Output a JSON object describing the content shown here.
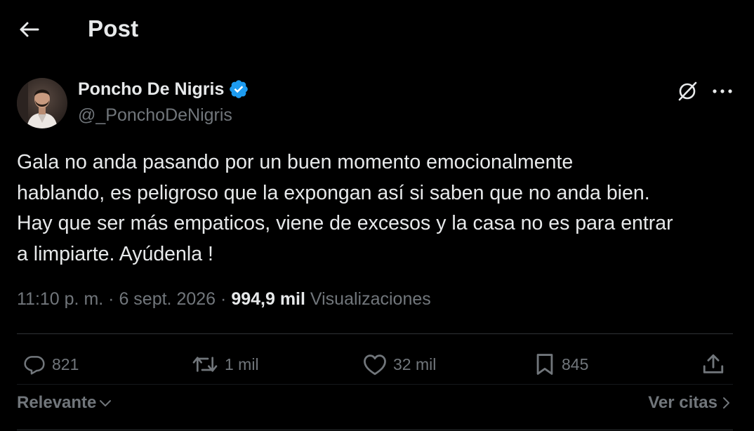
{
  "header": {
    "title": "Post",
    "back_icon": "arrow-left-icon"
  },
  "author": {
    "name": "Poncho De Nigris",
    "handle": "@_PonchoDeNigris",
    "verified": true,
    "verified_color": "#1d9bf0"
  },
  "tweet": {
    "lines": [
      "Gala no anda pasando por un buen momento emocionalmente",
      "hablando, es peligroso que la expongan así si saben que no anda bien.",
      "Hay que ser más empaticos, viene de excesos y la casa no es para entrar",
      "a limpiarte. Ayúdenla !"
    ]
  },
  "meta": {
    "time": "11:10 p. m.",
    "date": "6 sept. 2026",
    "separator": "·",
    "views_count": "994,9 mil",
    "views_label": "Visualizaciones"
  },
  "actions": {
    "replies": "821",
    "reposts": "1 mil",
    "likes": "32 mil",
    "bookmarks": "845"
  },
  "footer": {
    "sort_label": "Relevante",
    "quotes_label": "Ver citas"
  },
  "colors": {
    "background": "#000000",
    "text_primary": "#e7e9ea",
    "text_secondary": "#71767b",
    "divider": "#2f3336"
  }
}
